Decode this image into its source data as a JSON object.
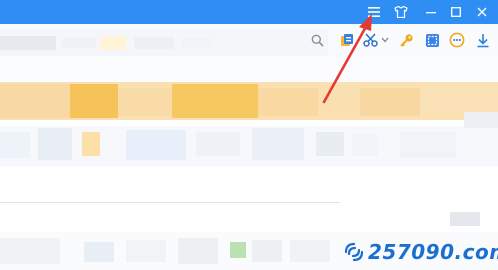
{
  "titlebar": {
    "color": "#2f8ef4",
    "controls": [
      {
        "icon": "menu-icon",
        "glyph": "≡"
      },
      {
        "icon": "skin-icon",
        "glyph": ""
      },
      {
        "icon": "minimize-icon",
        "glyph": "–"
      },
      {
        "icon": "maximize-icon",
        "glyph": "□"
      },
      {
        "icon": "close-icon",
        "glyph": "✕"
      }
    ]
  },
  "toolbar": {
    "icons": [
      "search-icon",
      "extension-icon",
      "scissors-icon",
      "key-icon",
      "screenshot-icon",
      "chat-icon",
      "download-icon"
    ]
  },
  "annotation": {
    "arrow_color": "#e53935",
    "points_to": "menu-icon"
  },
  "watermark": {
    "text": "257090.com"
  }
}
